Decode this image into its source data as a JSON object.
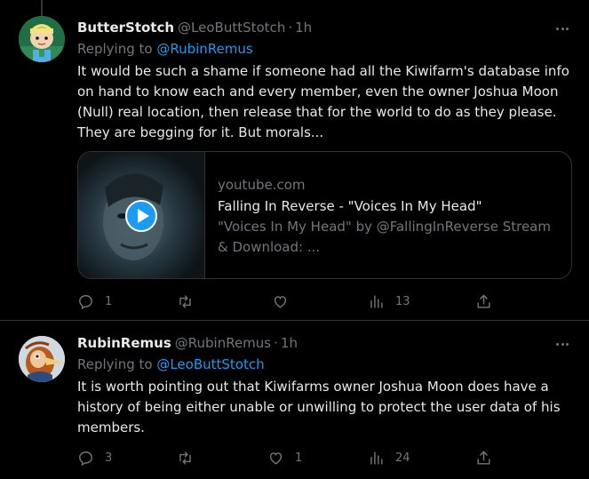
{
  "tweets": [
    {
      "display_name": "ButterStotch",
      "handle": "@LeoButtStotch",
      "separator": "·",
      "time": "1h",
      "replying_label": "Replying to ",
      "replying_to": "@RubinRemus",
      "body_lines": [
        "It would be such a shame if someone had all the Kiwifarm's database info",
        "on hand to know each and every member, even the owner Joshua Moon",
        "(Null) real location, then release that for the world to do as they please.",
        "They are begging for it. But morals..."
      ],
      "card": {
        "domain": "youtube.com",
        "title": "Falling In Reverse - \"Voices In My Head\"",
        "description": "\"Voices In My Head\" by @FallingInReverse Stream & Download: ..."
      },
      "actions": {
        "replies": "1",
        "retweets": "",
        "likes": "",
        "views": "13"
      }
    },
    {
      "display_name": "RubinRemus",
      "handle": "@RubinRemus",
      "separator": "·",
      "time": "1h",
      "replying_label": "Replying to ",
      "replying_to": "@LeoButtStotch",
      "body_lines": [
        "It is worth pointing out that Kiwifarms owner Joshua Moon does have a",
        "history of being either unable or unwilling to protect the user data of his",
        "members."
      ],
      "actions": {
        "replies": "3",
        "retweets": "",
        "likes": "1",
        "views": "24"
      }
    }
  ],
  "colors": {
    "background": "#000000",
    "text": "#e7e9ea",
    "muted": "#71767b",
    "accent": "#1d9bf0",
    "border": "#2f3336"
  },
  "icons": [
    "more-icon",
    "reply-icon",
    "retweet-icon",
    "like-icon",
    "views-icon",
    "share-icon",
    "play-icon"
  ]
}
